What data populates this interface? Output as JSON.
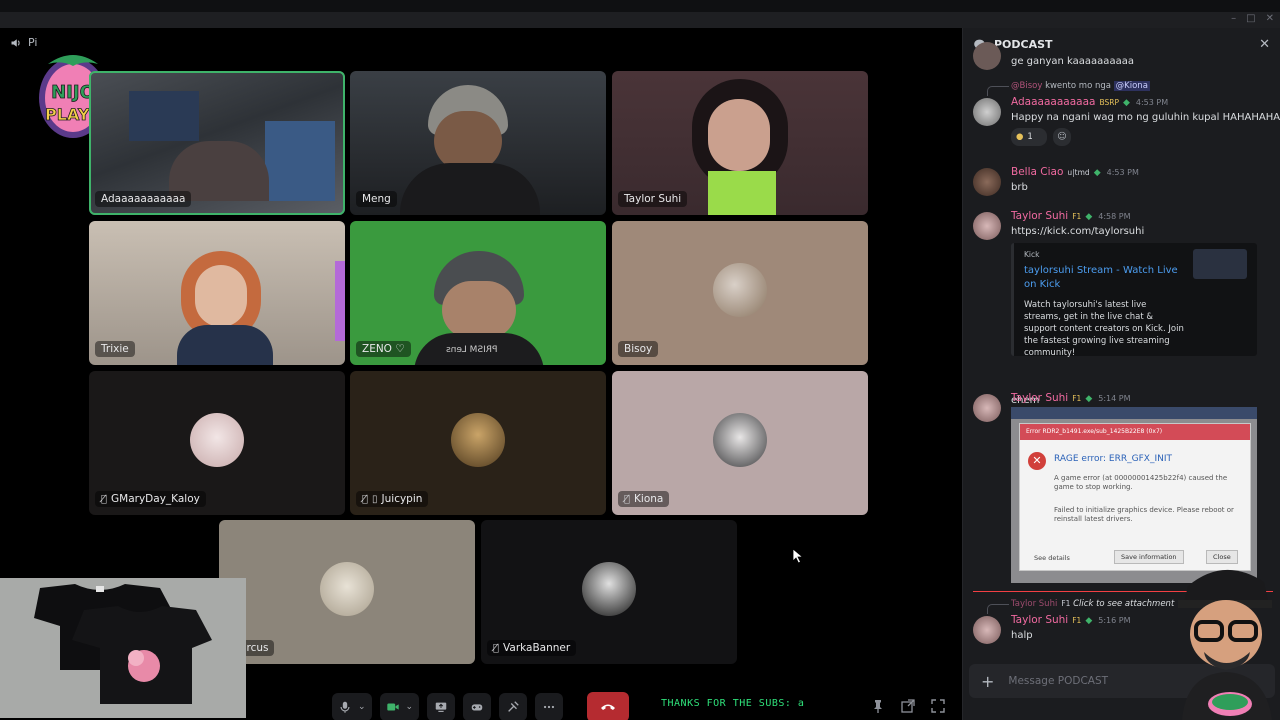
{
  "window": {
    "title": "Pi"
  },
  "voice": {
    "channel_short": "Pi"
  },
  "logo": {
    "text_top": "NIJO",
    "text_bottom": "PLAYS"
  },
  "tiles": [
    {
      "name": "Adaaaaaaaaaaa",
      "muted": false,
      "speaking": true
    },
    {
      "name": "Meng",
      "muted": false
    },
    {
      "name": "Taylor Suhi",
      "muted": false
    },
    {
      "name": "Trixie",
      "muted": false
    },
    {
      "name": "ZENO ♡",
      "muted": false
    },
    {
      "name": "Bisoy",
      "muted": false
    },
    {
      "name": "GMaryDay_Kaloy",
      "muted": true
    },
    {
      "name": "Juicypin",
      "muted": true
    },
    {
      "name": "Kiona",
      "muted": true
    },
    {
      "name": "Marcus",
      "muted": false
    },
    {
      "name": "VarkaBanner",
      "muted": true
    }
  ],
  "tile_overlays": {
    "zeno_shirt_text": "PRISM Lens"
  },
  "ticker": "THANKS FOR THE SUBS: a",
  "chat": {
    "title": "PODCAST",
    "close_label": "✕",
    "top_partial": "ge ganyan kaaaaaaaaaa",
    "messages": [
      {
        "reply_to_name": "@Bisoy",
        "reply_text": "kwento mo nga",
        "reply_mention": "@Kiona",
        "author": "Adaaaaaaaaaaa",
        "tag": "BSRP",
        "time": "4:53 PM",
        "text": "Happy na ngani wag mo ng guluhin kupal HAHAHAHA",
        "reaction_count": "1"
      },
      {
        "author": "Bella Ciao",
        "tag": "u|tmd",
        "time": "4:53 PM",
        "text": "brb"
      },
      {
        "author": "Taylor Suhi",
        "tag": "F1",
        "time": "4:58 PM",
        "link": "https://kick.com/taylorsuhi",
        "embed": {
          "provider": "Kick",
          "title": "taylorsuhi Stream - Watch Live on Kick",
          "description": "Watch taylorsuhi's latest live streams, get in the live chat & support content creators on Kick. Join the fastest growing live streaming community!"
        },
        "followup": "ehem"
      },
      {
        "author": "Taylor Suhi",
        "tag": "F1",
        "time": "5:14 PM",
        "attachment": {
          "bar": "Error RDR2_b1491.exe/sub_1425B22E8 (0x7)",
          "title": "RAGE error: ERR_GFX_INIT",
          "line1": "A game error (at 00000001425b22f4) caused the game to stop working.",
          "line2": "Failed to initialize graphics device. Please reboot or reinstall latest drivers.",
          "details": "See details",
          "save": "Save information",
          "close": "Close"
        }
      },
      {
        "reply_to_name": "Taylor Suhi",
        "reply_tag": "F1",
        "reply_text": "Click to see attachment",
        "author": "Taylor Suhi",
        "tag": "F1",
        "time": "5:16 PM",
        "text": "halp"
      }
    ],
    "composer_placeholder": "Message PODCAST"
  },
  "colors": {
    "accent_green": "#3fb36a",
    "hangup_red": "#b52b30",
    "name_pink": "#f06aa0",
    "link_blue": "#4c9df0",
    "ticker_green": "#2fe07a"
  }
}
